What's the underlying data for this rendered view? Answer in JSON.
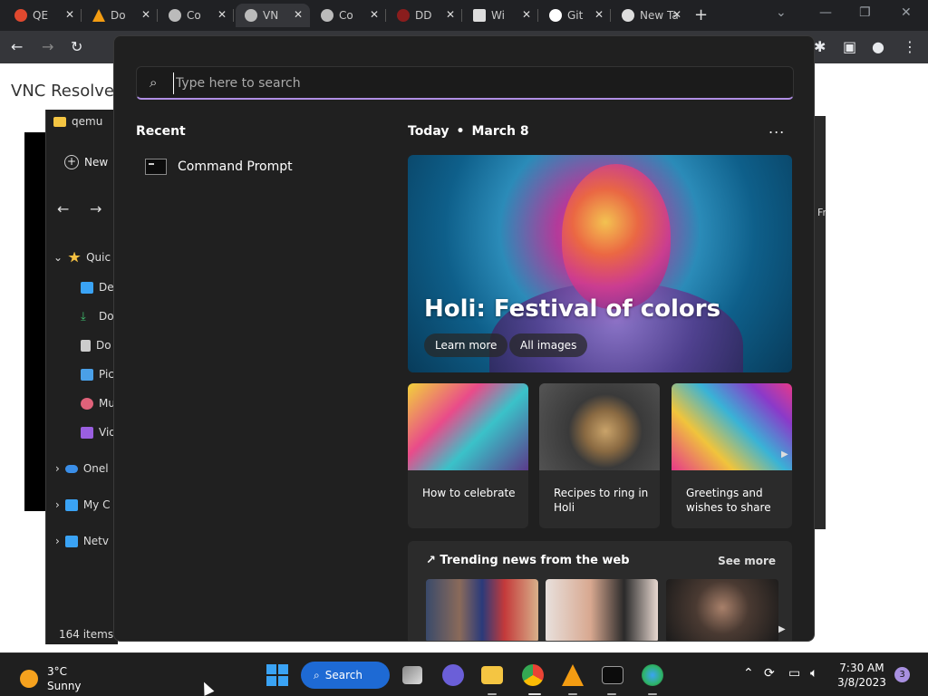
{
  "browser": {
    "tabs": [
      {
        "label": "QE",
        "color": "#e0492f"
      },
      {
        "label": "Do",
        "color": "#f39c12"
      },
      {
        "label": "Co",
        "color": "#bbbbbb"
      },
      {
        "label": "VN",
        "color": "#bbbbbb"
      },
      {
        "label": "Co",
        "color": "#bbbbbb"
      },
      {
        "label": "DD",
        "color": "#8a1d1d"
      },
      {
        "label": "Wi",
        "color": "#dddddd"
      },
      {
        "label": "Git",
        "color": "#ffffff"
      },
      {
        "label": "New Ta",
        "color": "#dddddd"
      }
    ],
    "page_title": "VNC Resolve"
  },
  "explorer": {
    "title": "qemu",
    "new_label": "New",
    "nav_items": [
      {
        "label": "Quic",
        "icon": "star-icon",
        "color": "#f6c142"
      },
      {
        "label": "Des",
        "icon": "desktop-icon",
        "color": "#3aa3f5"
      },
      {
        "label": "Do",
        "icon": "download-icon",
        "color": "#3fbf6f"
      },
      {
        "label": "Do",
        "icon": "document-icon",
        "color": "#cccccc"
      },
      {
        "label": "Pic",
        "icon": "pictures-icon",
        "color": "#4aa0e8"
      },
      {
        "label": "Mu",
        "icon": "music-icon",
        "color": "#e0627a"
      },
      {
        "label": "Vid",
        "icon": "video-icon",
        "color": "#9a5fe0"
      },
      {
        "label": "Onel",
        "icon": "cloud-icon",
        "color": "#3a8ee8"
      },
      {
        "label": "My C",
        "icon": "computer-icon",
        "color": "#3aa3f5"
      },
      {
        "label": "Netv",
        "icon": "network-icon",
        "color": "#3aa3f5"
      }
    ],
    "status": "164 items",
    "side_text": "Fr"
  },
  "start_menu": {
    "search_placeholder": "Type here to search",
    "recent_heading": "Recent",
    "recent_items": [
      "Command Prompt"
    ],
    "today_label": "Today",
    "date_label": "March 8",
    "more_label": "...",
    "hero": {
      "title": "Holi: Festival of colors",
      "learn_more": "Learn more",
      "all_images": "All images"
    },
    "cards": [
      {
        "label": "How to celebrate"
      },
      {
        "label": "Recipes to ring in Holi"
      },
      {
        "label": "Greetings and wishes to share"
      }
    ],
    "trending_heading": "↗ Trending news from the web",
    "see_more": "See more"
  },
  "taskbar": {
    "temperature": "3°C",
    "condition": "Sunny",
    "search_label": "Search",
    "time": "7:30 AM",
    "date": "3/8/2023",
    "notifications": "3"
  }
}
